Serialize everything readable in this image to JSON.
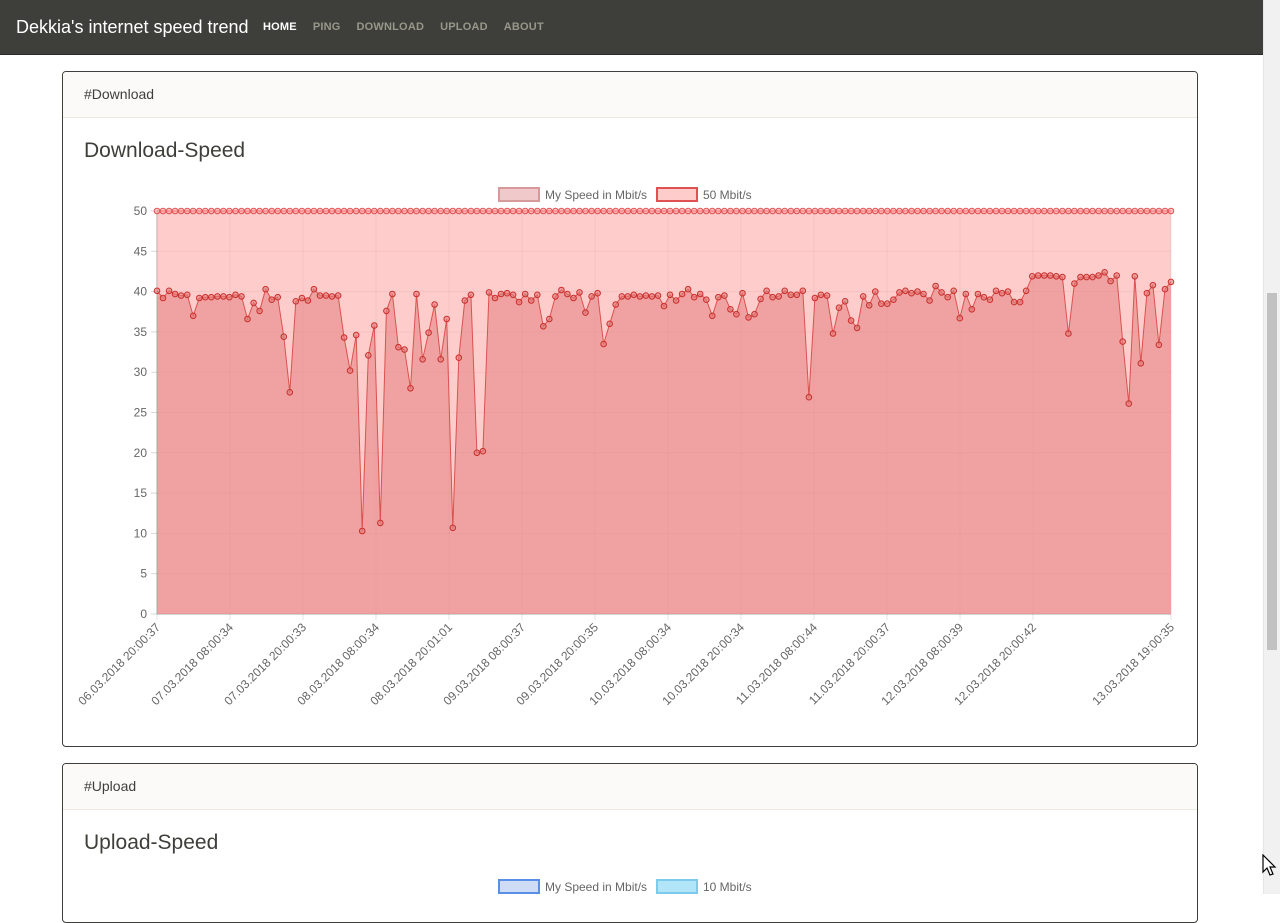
{
  "navbar": {
    "brand": "Dekkia's internet speed trend",
    "items": [
      {
        "label": "HOME",
        "active": true
      },
      {
        "label": "PING",
        "active": false
      },
      {
        "label": "DOWNLOAD",
        "active": false
      },
      {
        "label": "UPLOAD",
        "active": false
      },
      {
        "label": "ABOUT",
        "active": false
      }
    ]
  },
  "download_card": {
    "header": "#Download",
    "title": "Download-Speed"
  },
  "upload_card": {
    "header": "#Upload",
    "title": "Upload-Speed",
    "legend": [
      {
        "label": "My Speed in Mbit/s",
        "fill": "#cfdcf5",
        "stroke": "#5b8ee6"
      },
      {
        "label": "10 Mbit/s",
        "fill": "#b3e5f8",
        "stroke": "#7dcbea"
      }
    ]
  },
  "chart_data": {
    "type": "line",
    "title": "",
    "xlabel": "",
    "ylabel": "",
    "ylim": [
      0,
      50
    ],
    "yticks": [
      0,
      5,
      10,
      15,
      20,
      25,
      30,
      35,
      40,
      45,
      50
    ],
    "grid": true,
    "legend_position": "top",
    "x_tick_labels": [
      "06.03.2018 20:00:37",
      "07.03.2018 08:00:34",
      "07.03.2018 20:00:33",
      "08.03.2018 08:00:34",
      "08.03.2018 20:01:01",
      "09.03.2018 08:00:37",
      "09.03.2018 20:00:35",
      "10.03.2018 08:00:34",
      "10.03.2018 20:00:34",
      "11.03.2018 08:00:44",
      "11.03.2018 20:00:37",
      "12.03.2018 08:00:39",
      "12.03.2018 20:00:42",
      "13.03.2018 19:00:35"
    ],
    "series": [
      {
        "name": "My Speed in Mbit/s",
        "fill": "rgba(225,120,120,0.5)",
        "stroke": "#d9534f",
        "values": [
          40.1,
          39.2,
          40.1,
          39.7,
          39.5,
          39.6,
          37.0,
          39.2,
          39.3,
          39.3,
          39.4,
          39.4,
          39.3,
          39.6,
          39.4,
          36.6,
          38.6,
          37.6,
          40.3,
          39.0,
          39.3,
          34.4,
          27.5,
          38.8,
          39.2,
          38.9,
          40.3,
          39.5,
          39.5,
          39.4,
          39.5,
          34.3,
          30.2,
          34.6,
          10.3,
          32.1,
          35.8,
          11.3,
          37.6,
          39.7,
          33.1,
          32.8,
          28.0,
          39.7,
          31.6,
          34.9,
          38.4,
          31.6,
          36.6,
          10.7,
          31.8,
          38.9,
          39.6,
          20.0,
          20.2,
          39.9,
          39.2,
          39.7,
          39.8,
          39.6,
          38.7,
          39.7,
          38.9,
          39.6,
          35.7,
          36.6,
          39.4,
          40.2,
          39.7,
          39.2,
          39.9,
          37.4,
          39.4,
          39.8,
          33.5,
          36.0,
          38.4,
          39.4,
          39.4,
          39.6,
          39.4,
          39.5,
          39.4,
          39.5,
          38.2,
          39.6,
          38.9,
          39.7,
          40.3,
          39.3,
          39.7,
          39.0,
          37.0,
          39.3,
          39.5,
          37.8,
          37.2,
          39.8,
          36.8,
          37.2,
          39.1,
          40.1,
          39.3,
          39.4,
          40.1,
          39.6,
          39.6,
          40.1,
          26.9,
          39.2,
          39.6,
          39.5,
          34.8,
          38.0,
          38.8,
          36.4,
          35.5,
          39.4,
          38.3,
          40.0,
          38.5,
          38.5,
          39.0,
          39.9,
          40.1,
          39.8,
          40.0,
          39.7,
          38.9,
          40.7,
          39.9,
          39.3,
          40.1,
          36.7,
          39.7,
          37.8,
          39.7,
          39.3,
          39.0,
          40.1,
          39.8,
          40.0,
          38.7,
          38.7,
          40.1,
          41.9,
          42.0,
          42.0,
          42.0,
          41.9,
          41.8,
          34.8,
          41.0,
          41.8,
          41.8,
          41.8,
          42.0,
          42.4,
          41.3,
          42.0,
          33.8,
          26.1,
          41.9,
          31.1,
          39.8,
          40.8,
          33.4,
          40.3,
          41.2
        ]
      },
      {
        "name": "50 Mbit/s",
        "fill": "rgba(255,170,170,0.6)",
        "stroke": "#e05252",
        "constant": 50
      }
    ]
  }
}
